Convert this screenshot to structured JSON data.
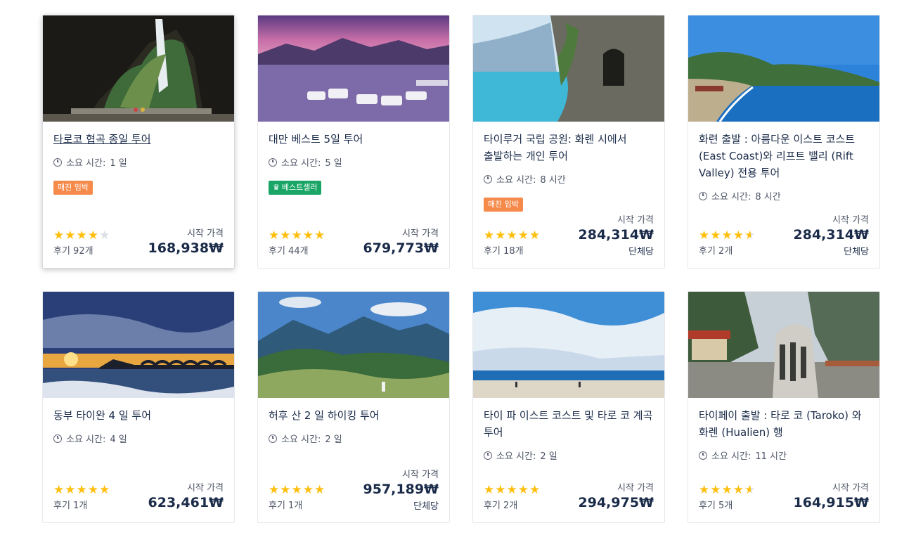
{
  "labels": {
    "duration_prefix": "소요 시간:",
    "price_from": "시작 가격",
    "per_group": "단체당"
  },
  "colors": {
    "accent_text": "#1a2b49",
    "star": "#ffbf0f",
    "badge_orange": "#f58a4b",
    "badge_green": "#18a565"
  },
  "tours": [
    {
      "title": "타로코 협곡 종일 투어",
      "duration": "1 일",
      "badge": "매진 임박",
      "badge_type": "orange",
      "rating": 4,
      "reviews": "후기 92개",
      "price": "168,938₩",
      "per_group": false,
      "image": "marble-gorge-tunnel"
    },
    {
      "title": "대만 베스트 5일 투어",
      "duration": "5 일",
      "badge": "베스트셀러",
      "badge_type": "green",
      "rating": 5,
      "reviews": "후기 44개",
      "price": "679,773₩",
      "per_group": false,
      "image": "sun-moon-lake-boats"
    },
    {
      "title": "타이루거 국립 공원: 화롄 시에서 출발하는 개인 투어",
      "duration": "8 시간",
      "badge": "매진 임박",
      "badge_type": "orange",
      "rating": 5,
      "reviews": "후기 18개",
      "price": "284,314₩",
      "per_group": true,
      "image": "coastal-cliff-tunnel"
    },
    {
      "title": "화련 출발 : 아름다운 이스트 코스트 (East Coast)와 리프트 밸리 (Rift Valley) 전용 투어",
      "duration": "8 시간",
      "badge": "",
      "badge_type": "",
      "rating": 4.5,
      "reviews": "후기 2개",
      "price": "284,314₩",
      "per_group": true,
      "image": "east-coast-bay"
    },
    {
      "title": "동부 타이완 4 일 투어",
      "duration": "4 일",
      "badge": "",
      "badge_type": "",
      "rating": 5,
      "reviews": "후기 1개",
      "price": "623,461₩",
      "per_group": false,
      "image": "sunrise-arched-bridge"
    },
    {
      "title": "허후 산 2 일 하이킹 투어",
      "duration": "2 일",
      "badge": "",
      "badge_type": "",
      "rating": 5,
      "reviews": "후기 1개",
      "price": "957,189₩",
      "per_group": true,
      "image": "mountain-meadow-hiker"
    },
    {
      "title": "타이 파 이스트 코스트 및 타로 코 계곡 투어",
      "duration": "2 일",
      "badge": "",
      "badge_type": "",
      "rating": 5,
      "reviews": "후기 2개",
      "price": "294,975₩",
      "per_group": false,
      "image": "beach-blue-sky"
    },
    {
      "title": "타이페이 출발 : 타로 코 (Taroko) 와 화렌 (Hualien) 행",
      "duration": "11 시간",
      "badge": "",
      "badge_type": "",
      "rating": 4.5,
      "reviews": "후기 5개",
      "price": "164,915₩",
      "per_group": false,
      "image": "park-entrance-stone"
    }
  ]
}
